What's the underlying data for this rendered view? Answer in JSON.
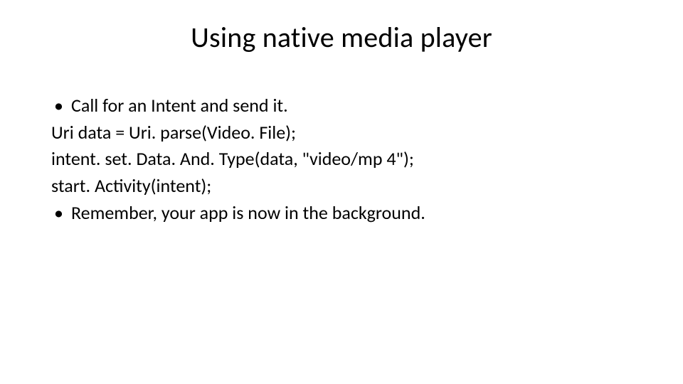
{
  "slide": {
    "title": "Using native media player",
    "lines": {
      "l0": "Call for an Intent and send it.",
      "l1": "Uri data = Uri. parse(Video. File);",
      "l2": "intent. set. Data. And. Type(data, \"video/mp 4\");",
      "l3": "start. Activity(intent);",
      "l4": "Remember, your app is now in the background."
    }
  }
}
